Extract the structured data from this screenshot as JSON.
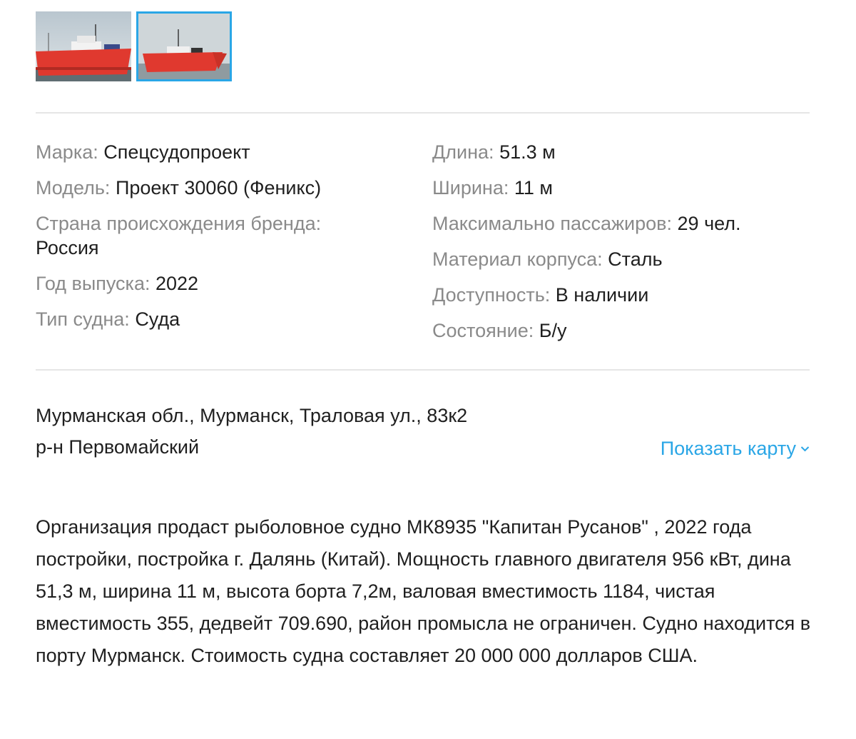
{
  "gallery": {
    "thumbnails": [
      {
        "icon": "ship-photo",
        "selected": false
      },
      {
        "icon": "ship-photo",
        "selected": true
      }
    ],
    "accent_color": "#2aa6e6",
    "hull_color": "#e0392f"
  },
  "specs": {
    "left": [
      {
        "label": "Марка:",
        "value": "Спецсудопроект"
      },
      {
        "label": "Модель:",
        "value": "Проект 30060 (Феникс)"
      },
      {
        "label": "Страна происхождения бренда:",
        "value": "Россия"
      },
      {
        "label": "Год выпуска:",
        "value": "2022"
      },
      {
        "label": "Тип судна:",
        "value": "Суда"
      }
    ],
    "right": [
      {
        "label": "Длина:",
        "value": "51.3 м"
      },
      {
        "label": "Ширина:",
        "value": "11 м"
      },
      {
        "label": "Максимально пассажиров:",
        "value": "29 чел."
      },
      {
        "label": "Материал корпуса:",
        "value": "Сталь"
      },
      {
        "label": "Доступность:",
        "value": "В наличии"
      },
      {
        "label": "Состояние:",
        "value": "Б/у"
      }
    ]
  },
  "location": {
    "address": "Мурманская обл., Мурманск, Траловая ул., 83к2",
    "district": "р-н Первомайский",
    "map_link": "Показать карту",
    "map_link_color": "#2aa6e6"
  },
  "description": "Организация продаст рыболовное судно МК8935 \"Капитан Русанов\" , 2022 года постройки, постройка г. Далянь (Китай). Мощность главного двигателя 956 кВт, дина 51,3 м, ширина 11 м, высота борта 7,2м, валовая вместимость 1184, чистая вместимость 355, дедвейт 709.690, район промысла не ограничен. Судно находится в порту Мурманск. Стоимость судна составляет 20 000 000 долларов США."
}
